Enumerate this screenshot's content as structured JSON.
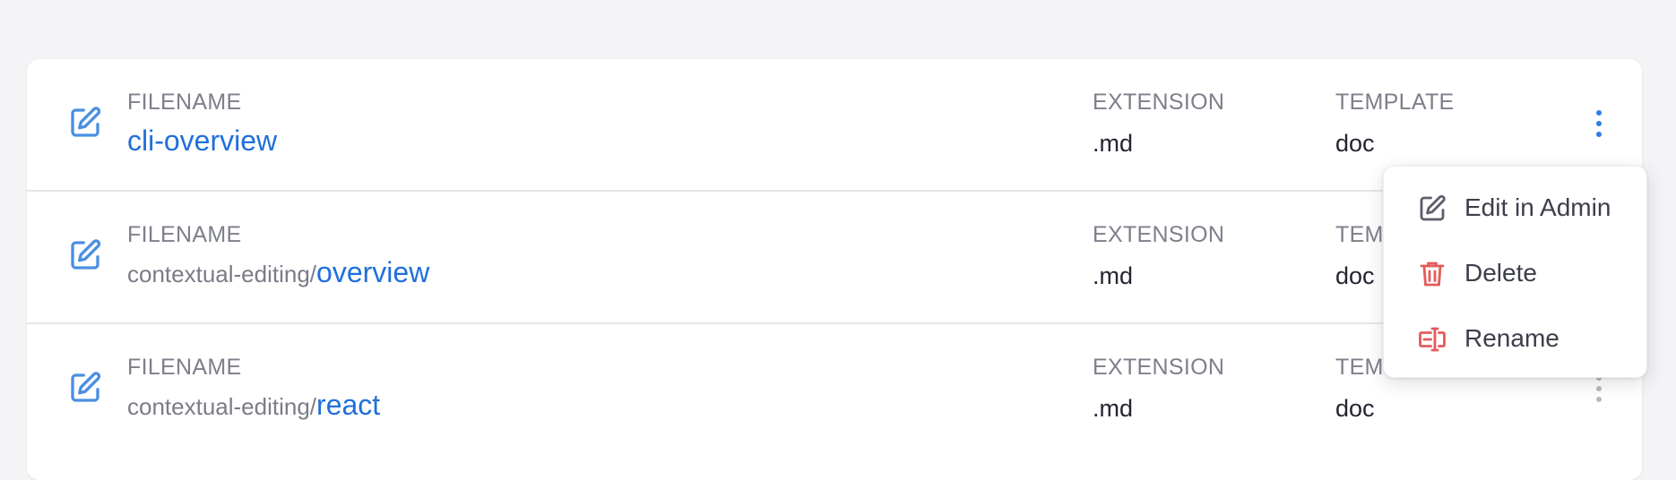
{
  "columns": {
    "filename": "FILENAME",
    "extension": "EXTENSION",
    "template": "TEMPLATE",
    "template_truncated": "TEMP"
  },
  "rows": [
    {
      "prefix": "",
      "name": "cli-overview",
      "extension": ".md",
      "template": "doc"
    },
    {
      "prefix": "contextual-editing/",
      "name": "overview",
      "extension": ".md",
      "template": "doc"
    },
    {
      "prefix": "contextual-editing/",
      "name": "react",
      "extension": ".md",
      "template": "doc"
    }
  ],
  "menu": {
    "edit": "Edit in Admin",
    "delete": "Delete",
    "rename": "Rename"
  },
  "icons": {
    "row": "edit-document-icon",
    "menu_edit": "edit-icon",
    "menu_delete": "trash-icon",
    "menu_rename": "rename-icon",
    "actions": "kebab-icon"
  },
  "colors": {
    "link": "#1f6fdb",
    "accent": "#2f7de6",
    "danger": "#e45c5c"
  }
}
